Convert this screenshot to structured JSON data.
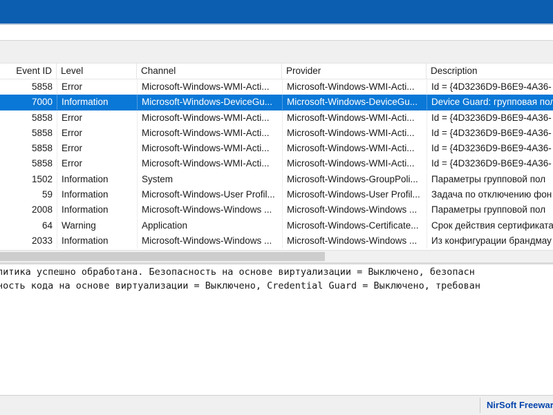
{
  "columns": {
    "event_id": "Event ID",
    "level": "Level",
    "channel": "Channel",
    "provider": "Provider",
    "description": "Description"
  },
  "rows": [
    {
      "event_id": "5858",
      "level": "Error",
      "channel": "Microsoft-Windows-WMI-Acti...",
      "provider": "Microsoft-Windows-WMI-Acti...",
      "description": "Id = {4D3236D9-B6E9-4A36-",
      "selected": false
    },
    {
      "event_id": "7000",
      "level": "Information",
      "channel": "Microsoft-Windows-DeviceGu...",
      "provider": "Microsoft-Windows-DeviceGu...",
      "description": "Device Guard: групповая пол",
      "selected": true
    },
    {
      "event_id": "5858",
      "level": "Error",
      "channel": "Microsoft-Windows-WMI-Acti...",
      "provider": "Microsoft-Windows-WMI-Acti...",
      "description": "Id = {4D3236D9-B6E9-4A36-",
      "selected": false
    },
    {
      "event_id": "5858",
      "level": "Error",
      "channel": "Microsoft-Windows-WMI-Acti...",
      "provider": "Microsoft-Windows-WMI-Acti...",
      "description": "Id = {4D3236D9-B6E9-4A36-",
      "selected": false
    },
    {
      "event_id": "5858",
      "level": "Error",
      "channel": "Microsoft-Windows-WMI-Acti...",
      "provider": "Microsoft-Windows-WMI-Acti...",
      "description": "Id = {4D3236D9-B6E9-4A36-",
      "selected": false
    },
    {
      "event_id": "5858",
      "level": "Error",
      "channel": "Microsoft-Windows-WMI-Acti...",
      "provider": "Microsoft-Windows-WMI-Acti...",
      "description": "Id = {4D3236D9-B6E9-4A36-",
      "selected": false
    },
    {
      "event_id": "1502",
      "level": "Information",
      "channel": "System",
      "provider": "Microsoft-Windows-GroupPoli...",
      "description": "Параметры групповой пол",
      "selected": false
    },
    {
      "event_id": "59",
      "level": "Information",
      "channel": "Microsoft-Windows-User Profil...",
      "provider": "Microsoft-Windows-User Profil...",
      "description": "Задача по отключению фон",
      "selected": false
    },
    {
      "event_id": "2008",
      "level": "Information",
      "channel": "Microsoft-Windows-Windows ...",
      "provider": "Microsoft-Windows-Windows ...",
      "description": "Параметры групповой пол",
      "selected": false
    },
    {
      "event_id": "64",
      "level": "Warning",
      "channel": "Application",
      "provider": "Microsoft-Windows-Certificate...",
      "description": "Срок действия сертификата",
      "selected": false
    },
    {
      "event_id": "2033",
      "level": "Information",
      "channel": "Microsoft-Windows-Windows ...",
      "provider": "Microsoft-Windows-Windows ...",
      "description": "Из конфигурации брандмау",
      "selected": false
    }
  ],
  "detail": {
    "lines": [
      "литика успешно обработана. Безопасность на основе виртуализации = Выключено, безопасн",
      "ность кода на основе виртуализации = Выключено, Credential Guard = Выключено, требован"
    ]
  },
  "status": {
    "link": "NirSoft Freeware"
  },
  "colors": {
    "titlebar": "#0c5fb0",
    "selection": "#0a78d7",
    "link": "#0645ad"
  }
}
